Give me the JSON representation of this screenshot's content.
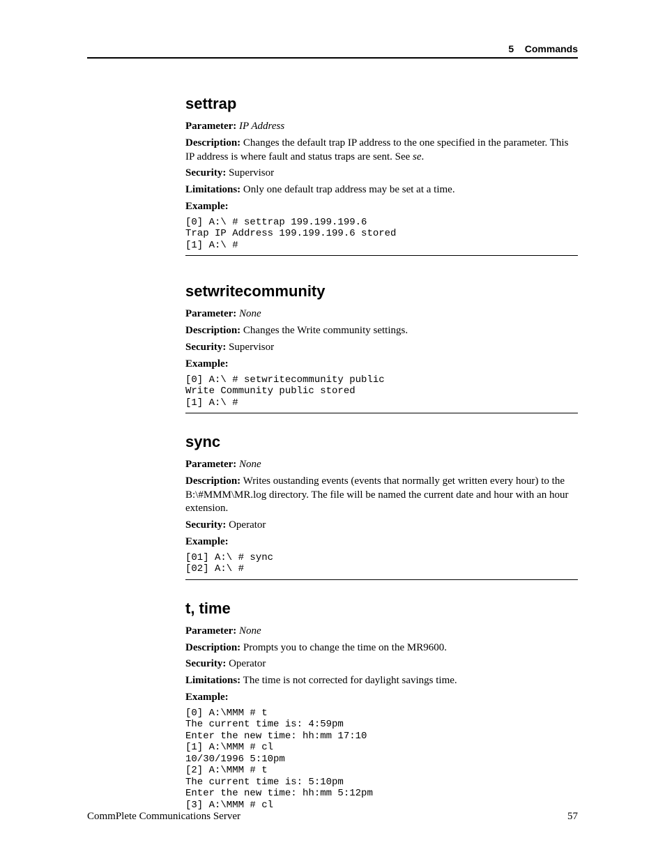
{
  "header": {
    "chapter_num": "5",
    "chapter_title": "Commands"
  },
  "sections": [
    {
      "heading": "settrap",
      "parameter_label": "Parameter:",
      "parameter_value": "IP Address",
      "description_label": "Description:",
      "description_text": " Changes the default trap IP address to the one specified in the parameter. This IP address is where fault and status traps are sent. See ",
      "description_tail_italic": "se",
      "description_tail_punct": ".",
      "security_label": "Security:",
      "security_value": " Supervisor",
      "limitations_label": "Limitations:",
      "limitations_value": " Only one default trap address may be set at a time.",
      "example_label": "Example:",
      "example_code": "[0] A:\\ # settrap 199.199.199.6\nTrap IP Address 199.199.199.6 stored\n[1] A:\\ #"
    },
    {
      "heading": "setwritecommunity",
      "parameter_label": "Parameter:",
      "parameter_value": "None",
      "description_label": "Description:",
      "description_text": " Changes the Write community settings.",
      "security_label": "Security:",
      "security_value": " Supervisor",
      "example_label": "Example:",
      "example_code": "[0] A:\\ # setwritecommunity public\nWrite Community public stored\n[1] A:\\ #"
    },
    {
      "heading": "sync",
      "parameter_label": "Parameter:",
      "parameter_value": "None",
      "description_label": "Description:",
      "description_text": " Writes oustanding events (events that normally get written every hour) to the B:\\#MMM\\MR.log directory.  The file will be named the current date and hour with an hour extension.",
      "security_label": "Security:",
      "security_value": " Operator",
      "example_label": "Example:",
      "example_code": "[01] A:\\ # sync\n[02] A:\\ #"
    },
    {
      "heading": "t, time",
      "parameter_label": "Parameter:",
      "parameter_value": "None",
      "description_label": "Description:",
      "description_text": " Prompts you to change the time on the MR9600.",
      "security_label": "Security:",
      "security_value": " Operator",
      "limitations_label": "Limitations:",
      "limitations_value": " The time is not corrected for daylight savings time.",
      "example_label": "Example:",
      "example_code_blocks": [
        "[0] A:\\MMM # t\nThe current time is: 4:59pm\nEnter the new time: hh:mm 17:10",
        "[1] A:\\MMM # cl\n10/30/1996 5:10pm",
        "[2] A:\\MMM # t\nThe current time is: 5:10pm\nEnter the new time: hh:mm 5:12pm",
        "[3] A:\\MMM # cl"
      ]
    }
  ],
  "footer": {
    "left": "CommPlete Communications Server",
    "right": "57"
  }
}
